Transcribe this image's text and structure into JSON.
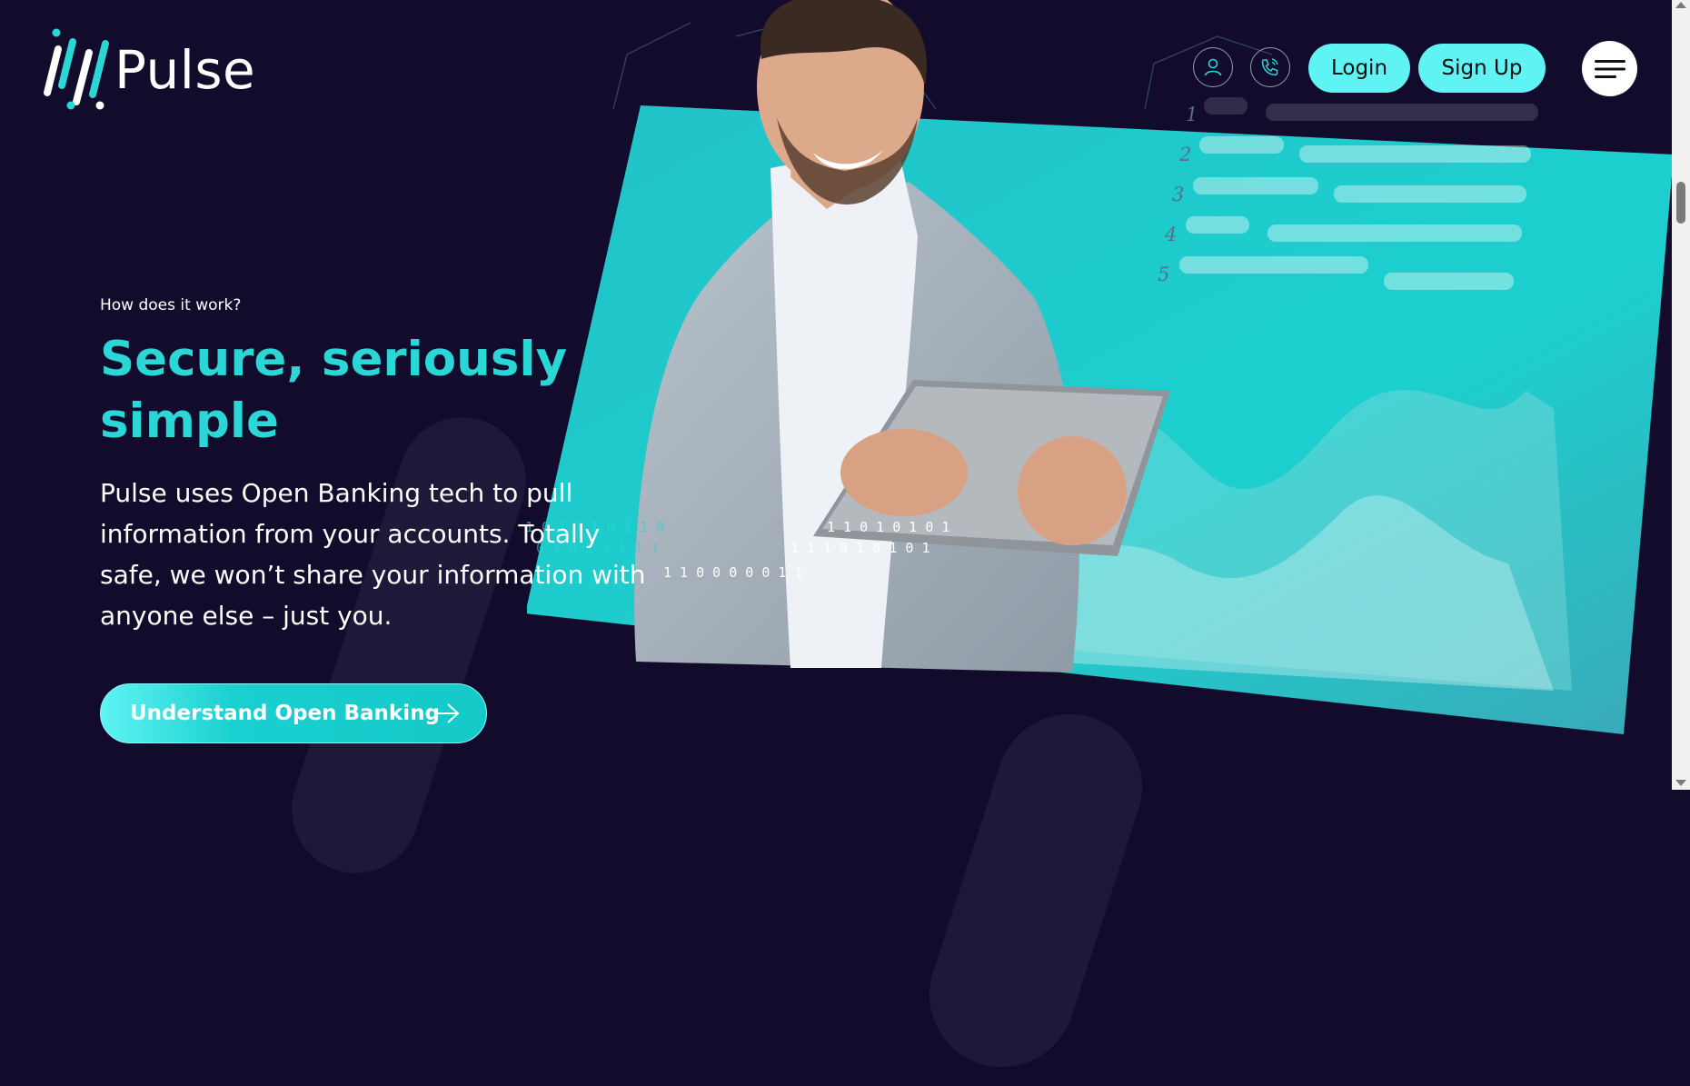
{
  "brand": {
    "name": "Pulse"
  },
  "header": {
    "login_label": "Login",
    "signup_label": "Sign Up",
    "icons": {
      "account": "user-icon",
      "contact": "phone-icon",
      "menu": "hamburger-menu-icon"
    }
  },
  "hero": {
    "eyebrow": "How does it work?",
    "title": "Secure, seriously simple",
    "description": "Pulse uses Open Banking tech to pull information from your accounts. Totally safe, we won’t share your information with anyone else – just you.",
    "cta_label": "Understand Open Banking",
    "list_numbers": [
      "1",
      "2",
      "3",
      "4",
      "5"
    ],
    "binary_text": "1 1 0 1 0 1 0 1 0 1 1 1 0 1 0 1 0 1 0 1 1 1 1 0 0 0 0 0 1 1"
  },
  "colors": {
    "background": "#130b2b",
    "accent": "#2ad6d6",
    "button": "#5ff3f3",
    "panel": "#20c8c8"
  }
}
